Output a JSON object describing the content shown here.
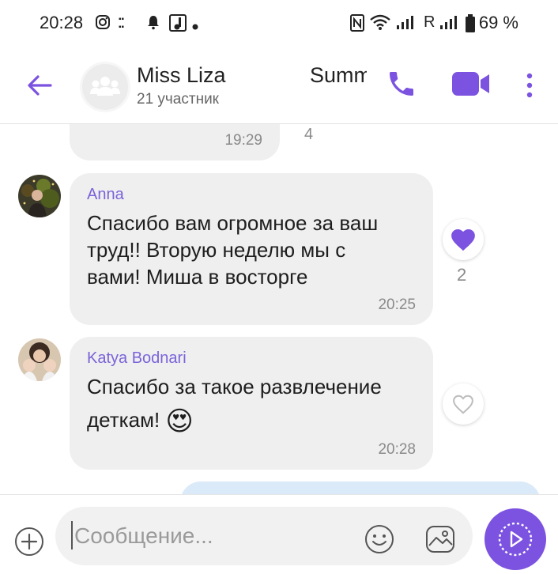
{
  "status_bar": {
    "time": "20:28",
    "carrier": "R",
    "battery": "69 %"
  },
  "header": {
    "title": "Miss Liza",
    "subtitle": "21 участник",
    "pinned_preview": "Summ"
  },
  "messages": [
    {
      "id": "prev",
      "time": "19:29",
      "likes": "4"
    },
    {
      "id": "anna",
      "sender": "Anna",
      "lines": [
        "Спасибо вам огромное за ваш",
        "труд!! Вторую неделю мы с",
        "вами! Миша в восторге"
      ],
      "time": "20:25",
      "likes": "2",
      "liked": true
    },
    {
      "id": "katya",
      "sender": "Katya Bodnari",
      "lines": [
        "Спасибо за такое развлечение",
        "деткам!"
      ],
      "emoji": "😍",
      "time": "20:28",
      "liked": false
    }
  ],
  "composer": {
    "placeholder": "Сообщение..."
  },
  "colors": {
    "accent": "#7c52e0",
    "sender": "#7b63d9",
    "bubble": "#efefef",
    "outgoing_bubble": "#dbeaf9"
  }
}
